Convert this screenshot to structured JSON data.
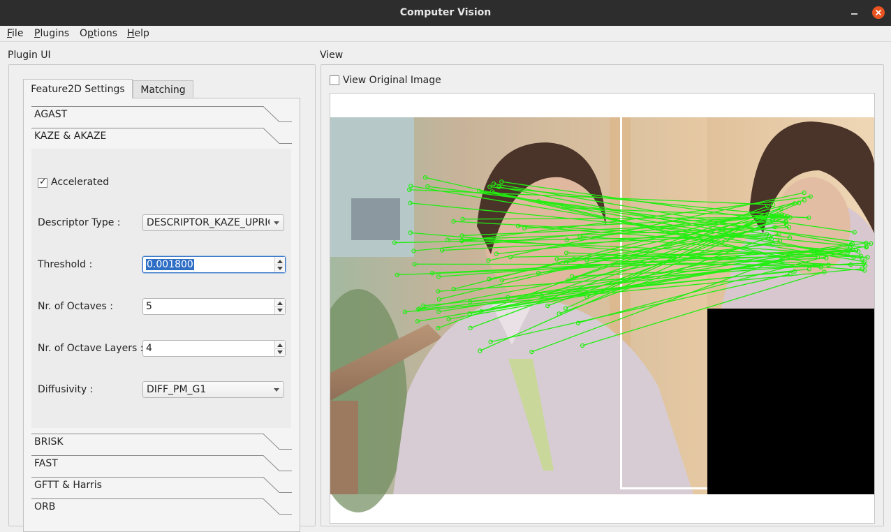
{
  "window": {
    "title": "Computer Vision"
  },
  "menu": [
    {
      "mnemonic": "F",
      "rest": "ile"
    },
    {
      "mnemonic": "P",
      "rest": "lugins"
    },
    {
      "pre": "O",
      "mnemonic": "p",
      "rest": "tions"
    },
    {
      "mnemonic": "H",
      "rest": "elp"
    }
  ],
  "left_group": {
    "title": "Plugin UI"
  },
  "tabs": {
    "active": "Feature2D Settings",
    "inactive": "Matching"
  },
  "toolbox": {
    "items_top": [
      "AGAST",
      "KAZE & AKAZE"
    ],
    "items_bottom": [
      "BRISK",
      "FAST",
      "GFTT & Harris",
      "ORB"
    ]
  },
  "kaze": {
    "accelerated_label": "Accelerated",
    "accelerated_checked": true,
    "check_mark": "✓",
    "descriptor_label": "Descriptor Type :",
    "descriptor_value": "DESCRIPTOR_KAZE_UPRIGHT",
    "threshold_label": "Threshold :",
    "threshold_value": "0.001800",
    "octaves_label": "Nr. of Octaves :",
    "octaves_value": "5",
    "layers_label": "Nr. of Octave Layers :",
    "layers_value": "4",
    "diffusivity_label": "Diffusivity :",
    "diffusivity_value": "DIFF_PM_G1"
  },
  "view": {
    "title": "View",
    "original_label": "View Original Image",
    "original_checked": false,
    "match_line_color": "#22ee11"
  }
}
